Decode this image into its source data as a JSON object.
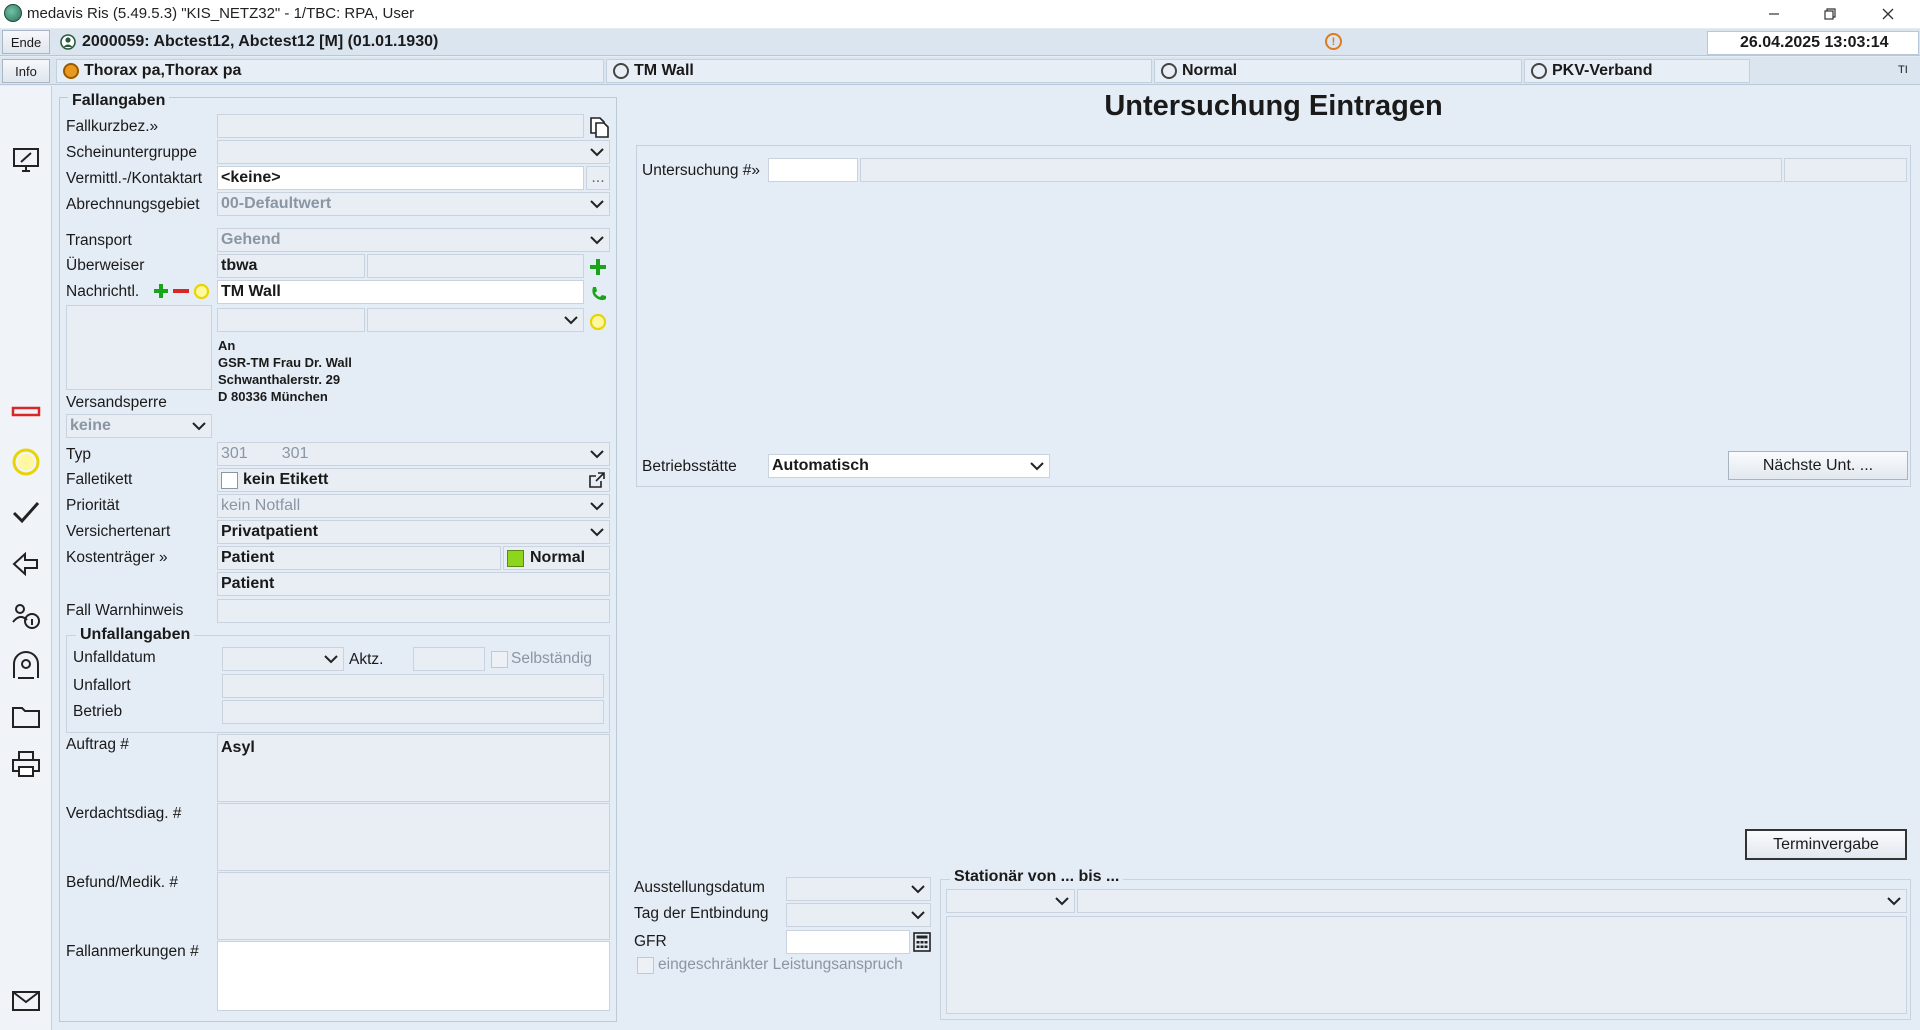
{
  "window": {
    "title": "medavis Ris (5.49.5.3) \"KIS_NETZ32\" - 1/TBC: RPA, User"
  },
  "patientbar": {
    "ende_label": "Ende",
    "patient": "2000059: Abctest12, Abctest12 [M] (01.01.1930)",
    "datetime": "26.04.2025 13:03:14"
  },
  "infobar": {
    "info_label": "Info",
    "exam": "Thorax pa,Thorax pa",
    "doctor": "TM Wall",
    "priority": "Normal",
    "insurance": "PKV-Verband",
    "corner": "TI"
  },
  "fall": {
    "group_title": "Fallangaben",
    "fallkurzbez_label": "Fallkurzbez.»",
    "fallkurzbez_value": "",
    "scheinuntergruppe_label": "Scheinuntergruppe",
    "scheinuntergruppe_value": "",
    "vermittl_label": "Vermittl.-/Kontaktart",
    "vermittl_value": "<keine>",
    "vermittl_btn": "...",
    "abrechnungsgebiet_label": "Abrechnungsgebiet",
    "abrechnungsgebiet_value": "00-Defaultwert",
    "transport_label": "Transport",
    "transport_value": "Gehend",
    "ueberweiser_label": "Überweiser",
    "ueberweiser_value": "tbwa",
    "nachricht_label": "Nachrichtl.",
    "nachricht_value": "TM Wall",
    "address": [
      "An",
      "GSR-TM Frau Dr. Wall",
      "Schwanthalerstr. 29",
      "D 80336 München"
    ],
    "versandsperre_label": "Versandsperre",
    "versandsperre_value": "keine",
    "typ_label": "Typ",
    "typ_value1": "301",
    "typ_value2": "301",
    "falletikett_label": "Falletikett",
    "falletikett_value": "kein Etikett",
    "prioritaet_label": "Priorität",
    "prioritaet_value": "kein Notfall",
    "versichertenart_label": "Versichertenart",
    "versichertenart_value": "Privatpatient",
    "kostentraeger_label": "Kostenträger »",
    "kostentraeger_value": "Patient",
    "kostentraeger_status": "Normal",
    "kostentraeger_value2": "Patient",
    "warnhinweis_label": "Fall Warnhinweis",
    "unfall_title": "Unfallangaben",
    "unfalldatum_label": "Unfalldatum",
    "aktz_label": "Aktz.",
    "selbstaendig_label": "Selbständig",
    "unfallort_label": "Unfallort",
    "betrieb_label": "Betrieb",
    "auftrag_label": "Auftrag #",
    "auftrag_value": "Asyl",
    "verdacht_label": "Verdachtsdiag. #",
    "befund_label": "Befund/Medik. #",
    "fallanmerkungen_label": "Fallanmerkungen #"
  },
  "main": {
    "heading": "Untersuchung Eintragen",
    "untersuchung_label": "Untersuchung #»",
    "betriebsstaette_label": "Betriebsstätte",
    "betriebsstaette_value": "Automatisch",
    "naechste_btn": "Nächste Unt. ...",
    "terminvergabe_btn": "Terminvergabe",
    "ausstellungsdatum_label": "Ausstellungsdatum",
    "entbindung_label": "Tag der Entbindung",
    "gfr_label": "GFR",
    "leistungsanspruch_label": "eingeschränkter Leistungsanspruch",
    "stationaer_label": "Stationär von ... bis ..."
  },
  "colors": {
    "background": "#e4ecf5",
    "status_green": "#8ed61e",
    "add_green": "#1aa41a",
    "remove_red": "#d92626",
    "attention_yellow": "#e8d400"
  }
}
